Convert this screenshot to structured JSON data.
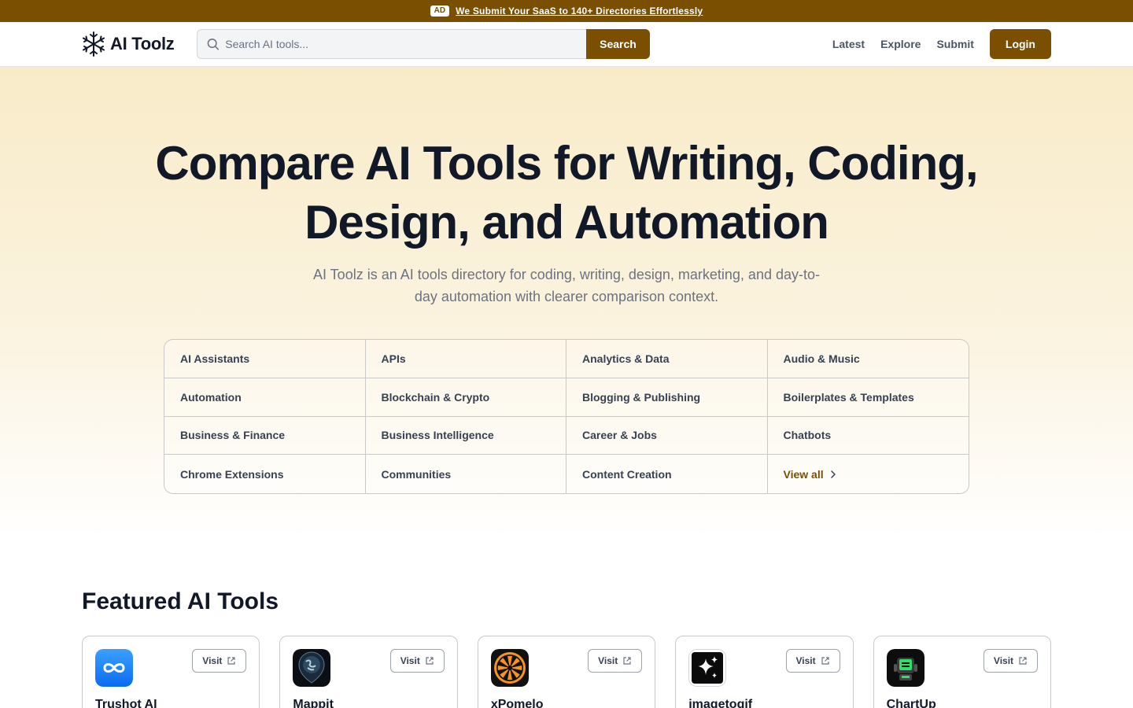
{
  "adbar": {
    "badge": "AD",
    "text": "We Submit Your SaaS to 140+ Directories Effortlessly"
  },
  "header": {
    "logo_text": "AI Toolz",
    "search_placeholder": "Search AI tools...",
    "search_button": "Search",
    "nav": {
      "latest": "Latest",
      "explore": "Explore",
      "submit": "Submit",
      "login": "Login"
    }
  },
  "hero": {
    "title": "Compare AI Tools for Writing, Coding, Design, and Automation",
    "subtitle": "AI Toolz is an AI tools directory for coding, writing, design, marketing, and day-to-day automation with clearer comparison context."
  },
  "categories": [
    "AI Assistants",
    "APIs",
    "Analytics & Data",
    "Audio & Music",
    "Automation",
    "Blockchain & Crypto",
    "Blogging & Publishing",
    "Boilerplates & Templates",
    "Business & Finance",
    "Business Intelligence",
    "Career & Jobs",
    "Chatbots",
    "Chrome Extensions",
    "Communities",
    "Content Creation"
  ],
  "view_all": "View all",
  "featured": {
    "title": "Featured AI Tools",
    "visit_label": "Visit",
    "tools": [
      {
        "name": "Trushot AI",
        "icon": "infinity-icon"
      },
      {
        "name": "Mappit",
        "icon": "globe-icon"
      },
      {
        "name": "xPomelo",
        "icon": "citrus-icon"
      },
      {
        "name": "imagetogif",
        "icon": "sparkle-icon"
      },
      {
        "name": "ChartUp",
        "icon": "robot-icon"
      }
    ]
  },
  "colors": {
    "brand": "#7b4f01",
    "text": "#111827",
    "muted": "#6b7280"
  }
}
